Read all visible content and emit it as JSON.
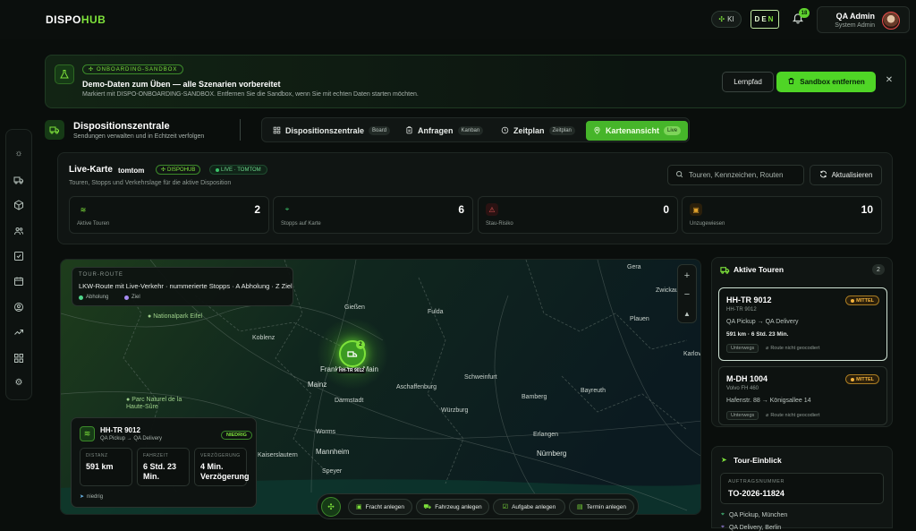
{
  "app": {
    "logo_main": "DISPO",
    "logo_accent": "HUB"
  },
  "topbar": {
    "ki_label": "KI",
    "lang_first": "DE",
    "lang_second": "N",
    "notifications_count": "18",
    "user_name": "QA Admin",
    "user_role": "System Admin"
  },
  "banner": {
    "tag": "ONBOARDING-SANDBOX",
    "title": "Demo-Daten zum Üben — alle Szenarien vorbereitet",
    "subtitle": "Markiert mit DISPO-ONBOARDING-SANDBOX. Entfernen Sie die Sandbox, wenn Sie mit echten Daten starten möchten.",
    "learn_label": "Lernpfad",
    "remove_label": "Sandbox entfernen"
  },
  "header": {
    "title": "Dispositionszentrale",
    "subtitle": "Sendungen verwalten und in Echtzeit verfolgen"
  },
  "tabs": [
    {
      "label": "Dispositionszentrale",
      "badge": "Board"
    },
    {
      "label": "Anfragen",
      "badge": "Kanban"
    },
    {
      "label": "Zeitplan",
      "badge": "Zeitplan"
    },
    {
      "label": "Kartenansicht",
      "badge": "Live"
    }
  ],
  "live": {
    "title": "Live-Karte",
    "provider": "tomtom",
    "badge_dispohub": "DISPOHUB",
    "badge_live": "LIVE · TOMTOM",
    "subtitle": "Touren, Stopps und Verkehrslage für die aktive Disposition",
    "search_placeholder": "Touren, Kennzeichen, Routen",
    "refresh_label": "Aktualisieren",
    "stats": [
      {
        "label": "Aktive Touren",
        "value": "2",
        "color": "#7ee23b"
      },
      {
        "label": "Stopps auf Karte",
        "value": "6",
        "color": "#3cc36a"
      },
      {
        "label": "Stau-Risiko",
        "value": "0",
        "color": "#e25555"
      },
      {
        "label": "Unzugewiesen",
        "value": "10",
        "color": "#e0a22c"
      }
    ]
  },
  "map": {
    "route_tag": "TOUR-ROUTE",
    "route_title": "LKW-Route mit Live-Verkehr · nummerierte Stopps · A Abholung · Z Ziel",
    "legend_pickup": "Abholung",
    "legend_target": "Ziel",
    "marker_label": "HH-TR 9012",
    "marker_count": "2",
    "places": {
      "giessen": "Gießen",
      "fulda": "Fulda",
      "koblenz": "Koblenz",
      "frankfurt": "Frankfurt am Main",
      "mainz": "Mainz",
      "darmstadt": "Darmstadt",
      "aschaffenburg": "Aschaffenburg",
      "schweinfurt": "Schweinfurt",
      "bamberg": "Bamberg",
      "bayreuth": "Bayreuth",
      "wuerzburg": "Würzburg",
      "erlangen": "Erlangen",
      "nuernberg": "Nürnberg",
      "worms": "Worms",
      "mannheim": "Mannheim",
      "speyer": "Speyer",
      "kaiserslautern": "Kaiserslautern",
      "gera": "Gera",
      "zwickau": "Zwickau",
      "plauen": "Plauen",
      "karlovy": "Karlov",
      "park_eifel": "Nationalpark Eifel",
      "park_haute": "Parc Naturel de la Haute-Sûre"
    }
  },
  "tour_card": {
    "name": "HH-TR 9012",
    "route": "QA Pickup → QA Delivery",
    "priority": "NIEDRIG",
    "distance_label": "DISTANZ",
    "distance_value": "591 km",
    "duration_label": "FAHRZEIT",
    "duration_value": "6 Std. 23 Min.",
    "delay_label": "VERZÖGERUNG",
    "delay_value": "4 Min. Verzögerung",
    "footer": "niedrig"
  },
  "actions": [
    {
      "label": "Fracht anlegen"
    },
    {
      "label": "Fahrzeug anlegen"
    },
    {
      "label": "Aufgabe anlegen"
    },
    {
      "label": "Termin anlegen"
    }
  ],
  "active_tours": {
    "title": "Aktive Touren",
    "count": "2",
    "items": [
      {
        "name": "HH-TR 9012",
        "vehicle": "HH-TR 9012",
        "route": "QA Pickup → QA Delivery",
        "meta": "591 km · 6 Std. 23 Min.",
        "priority": "MITTEL",
        "chip": "Unterwegs",
        "nogeo": "Route nicht geocodiert"
      },
      {
        "name": "M-DH 1004",
        "vehicle": "Volvo FH 460",
        "route": "Hafenstr. 88 → Königsallee 14",
        "priority": "MITTEL",
        "chip": "Unterwegs",
        "nogeo": "Route nicht geocodiert"
      }
    ]
  },
  "insight": {
    "title": "Tour-Einblick",
    "order_label": "AUFTRAGSNUMMER",
    "order_value": "TO-2026-11824",
    "stop1": "QA Pickup, München",
    "stop2": "QA Delivery, Berlin"
  }
}
